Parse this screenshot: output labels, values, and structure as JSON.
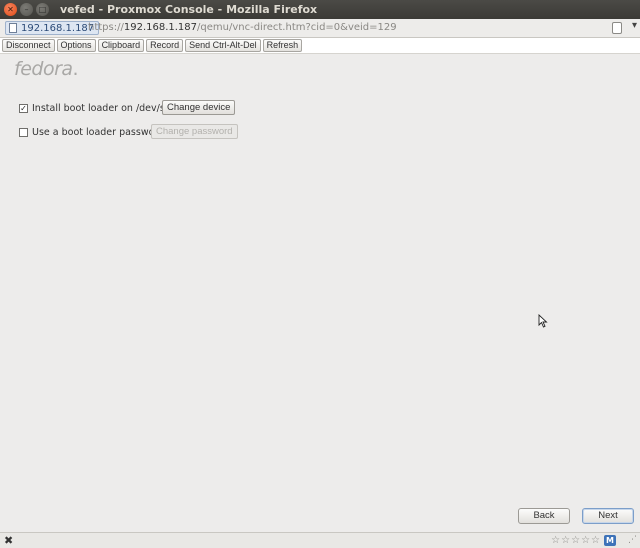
{
  "window": {
    "title": "vefed - Proxmox Console - Mozilla Firefox"
  },
  "urlbar": {
    "identity": "192.168.1.187",
    "url_prefix": "https://",
    "url_host": "192.168.1.187",
    "url_path": "/qemu/vnc-direct.htm?cid=0&veid=129"
  },
  "vnc_toolbar": {
    "buttons": [
      "Disconnect",
      "Options",
      "Clipboard",
      "Record",
      "Send Ctrl-Alt-Del",
      "Refresh"
    ]
  },
  "installer": {
    "logo": "fedora",
    "boot_loader": {
      "checked": true,
      "label": "Install boot loader on /dev/sda.",
      "button": "Change device"
    },
    "password": {
      "checked": false,
      "label": "Use a boot loader password",
      "button": "Change password"
    },
    "back": "Back",
    "next": "Next"
  },
  "statusbar": {
    "close_symbol": "✖",
    "addon_label": "M"
  },
  "colors": {
    "titlebar": "#3c3b37",
    "close_button": "#df4a16",
    "console_bg": "#edeceb",
    "default_button_border": "#7c9ec9"
  }
}
